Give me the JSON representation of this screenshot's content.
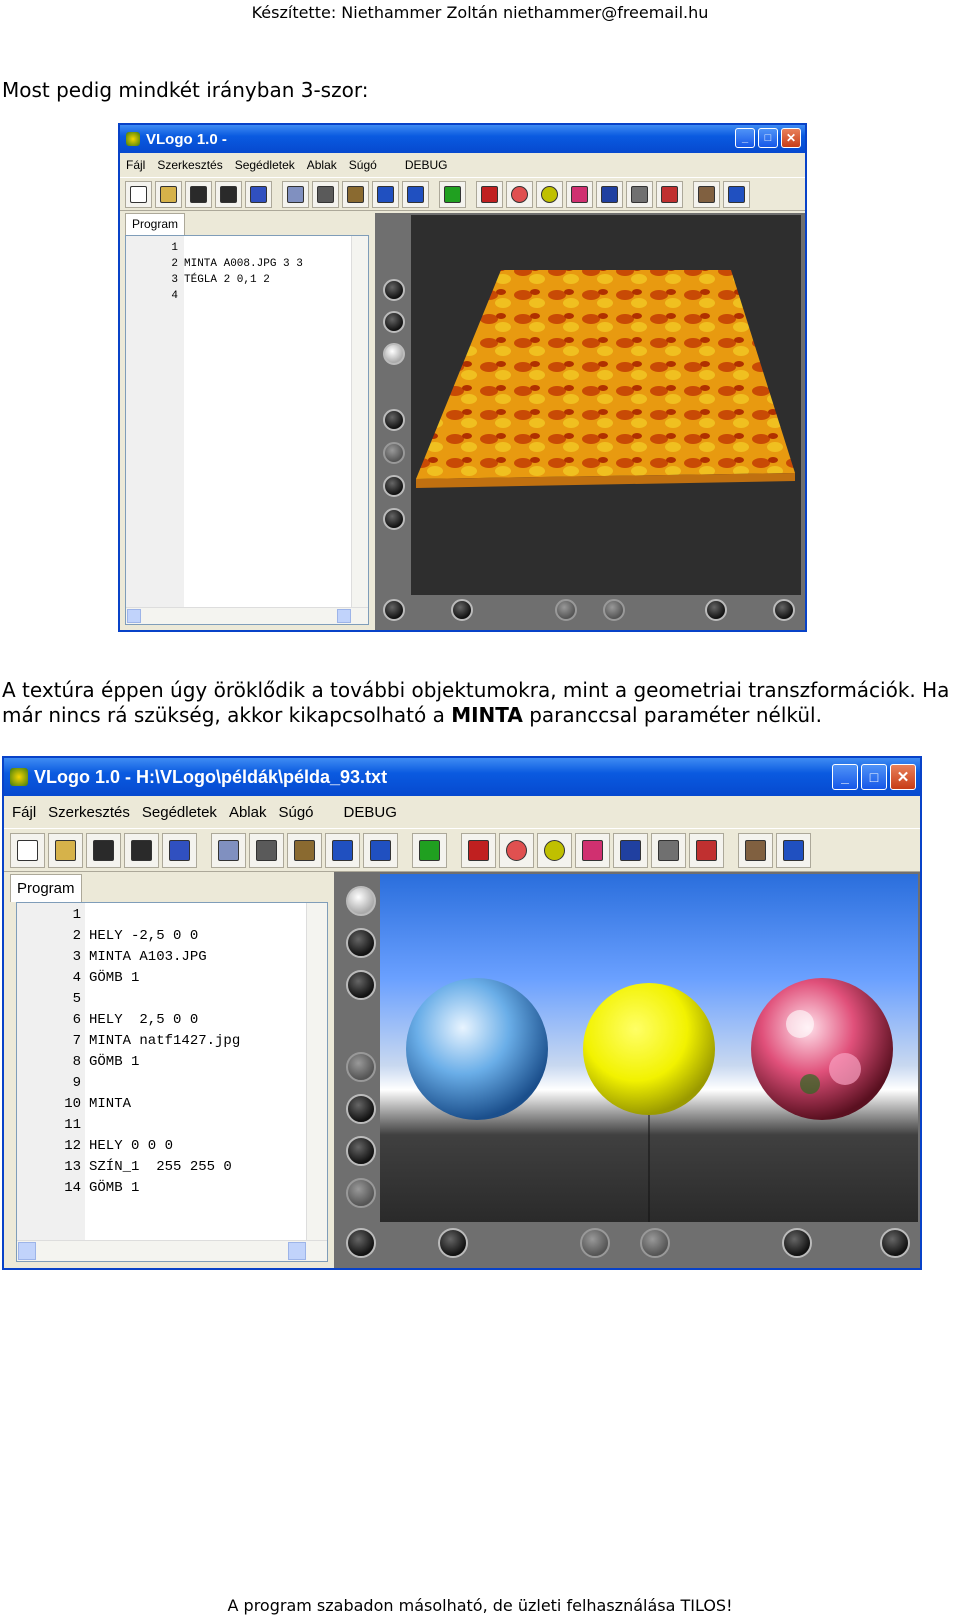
{
  "header": "Készítette: Niethammer Zoltán  niethammer@freemail.hu",
  "intro": "Most pedig mindkét irányban 3-szor:",
  "paragraph": {
    "before": "A textúra éppen úgy öröklődik a további objektumokra, mint a geometriai transzformációk. Ha már nincs rá szükség, akkor kikapcsolható a ",
    "bold": "MINTA",
    "after": " paranccsal paraméter nélkül."
  },
  "footer": "A program szabadon másolható, de üzleti felhasználása TILOS!",
  "window1": {
    "title": "VLogo 1.0 -",
    "menu": [
      "Fájl",
      "Szerkesztés",
      "Segédletek",
      "Ablak",
      "Súgó",
      "DEBUG"
    ],
    "tab": "Program",
    "lines": [
      {
        "n": "1",
        "t": ""
      },
      {
        "n": "2",
        "t": "MINTA A008.JPG 3 3"
      },
      {
        "n": "3",
        "t": "TÉGLA 2 0,1 2"
      },
      {
        "n": "4",
        "t": ""
      }
    ]
  },
  "window2": {
    "title": "VLogo 1.0 - H:\\VLogo\\példák\\példa_93.txt",
    "menu": [
      "Fájl",
      "Szerkesztés",
      "Segédletek",
      "Ablak",
      "Súgó",
      "DEBUG"
    ],
    "tab": "Program",
    "lines": [
      {
        "n": "1",
        "t": ""
      },
      {
        "n": "2",
        "t": "HELY -2,5 0 0"
      },
      {
        "n": "3",
        "t": "MINTA A103.JPG"
      },
      {
        "n": "4",
        "t": "GÖMB 1"
      },
      {
        "n": "5",
        "t": ""
      },
      {
        "n": "6",
        "t": "HELY  2,5 0 0"
      },
      {
        "n": "7",
        "t": "MINTA natf1427.jpg"
      },
      {
        "n": "8",
        "t": "GÖMB 1"
      },
      {
        "n": "9",
        "t": ""
      },
      {
        "n": "10",
        "t": "MINTA"
      },
      {
        "n": "11",
        "t": ""
      },
      {
        "n": "12",
        "t": "HELY 0 0 0"
      },
      {
        "n": "13",
        "t": "SZÍN_1  255 255 0"
      },
      {
        "n": "14",
        "t": "GÖMB 1"
      }
    ]
  },
  "toolbar_icons": [
    "new-icon",
    "open-icon",
    "save-icon",
    "save-all-icon",
    "save-as-icon",
    "copy-icon",
    "cut-icon",
    "paste-icon",
    "undo-icon",
    "redo-icon",
    "run-check-icon",
    "grid-icon",
    "palette-icon",
    "ball-icon",
    "shapes-icon",
    "keyboard-icon",
    "printer-icon",
    "triangle-icon",
    "tools-icon",
    "refresh-icon"
  ],
  "colors": {
    "title_bar": "#0a5ae0",
    "toolbar_bg": "#ece9d8",
    "viewport_bg": "#2e2e2e",
    "sphere_yellow": "#ffff00"
  }
}
